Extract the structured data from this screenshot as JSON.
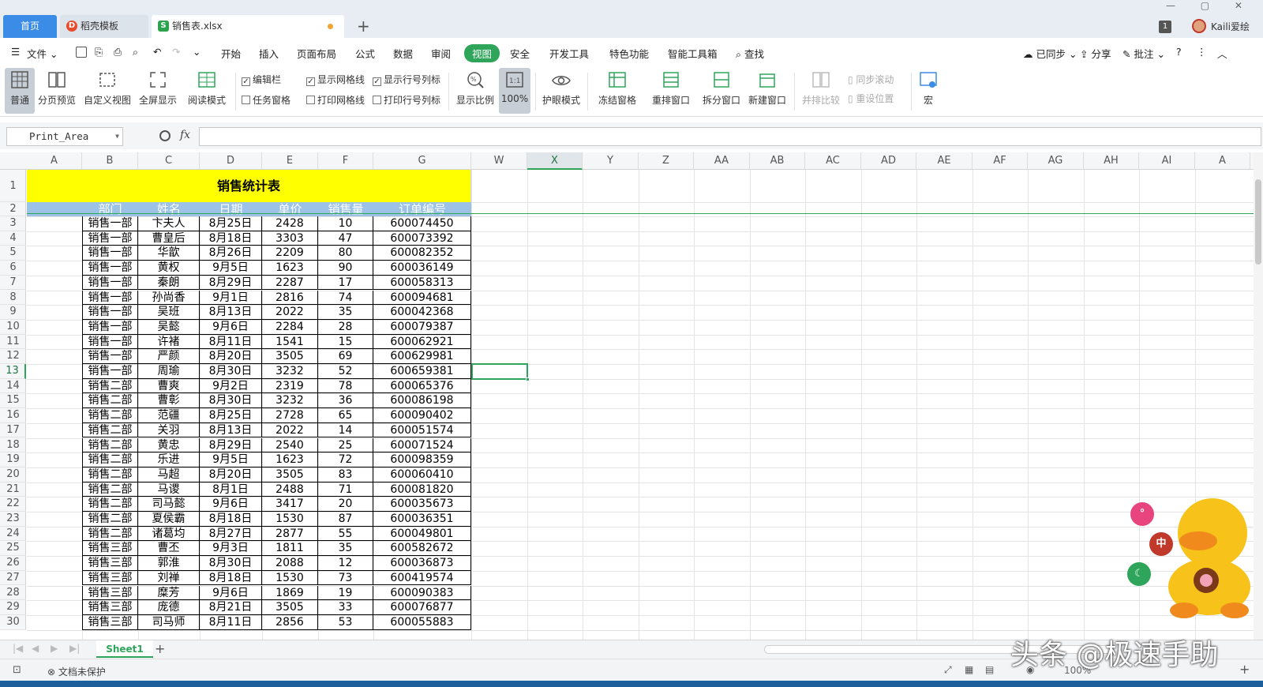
{
  "tabs": {
    "home": "首页",
    "template": "稻壳模板",
    "file": "销售表.xlsx",
    "file_icon": "S"
  },
  "top_right": {
    "badge": "1",
    "username": "Kaili爱绘"
  },
  "menu": {
    "file": "文件",
    "items": [
      "开始",
      "插入",
      "页面布局",
      "公式",
      "数据",
      "审阅",
      "视图",
      "安全",
      "开发工具",
      "特色功能",
      "智能工具箱"
    ],
    "search": "查找",
    "sync": "已同步",
    "share": "分享",
    "comment": "批注"
  },
  "ribbon": {
    "normal": "普通",
    "page_preview": "分页预览",
    "custom_view": "自定义视图",
    "fullscreen": "全屏显示",
    "reading_mode": "阅读模式",
    "edit_bar": "编辑栏",
    "task_pane": "任务窗格",
    "show_gridlines": "显示网格线",
    "print_gridlines": "打印网格线",
    "show_headings": "显示行号列标",
    "print_headings": "打印行号列标",
    "zoom": "显示比例",
    "zoom100": "100%",
    "eye_mode": "护眼模式",
    "freeze": "冻结窗格",
    "arrange": "重排窗口",
    "split": "拆分窗口",
    "new_window": "新建窗口",
    "side_by_side": "并排比较",
    "sync_scroll": "同步滚动",
    "reset_pos": "重设位置",
    "macro": "宏"
  },
  "formula_bar": {
    "name_box": "Print_Area",
    "fx": "fx",
    "value": ""
  },
  "columns": [
    "A",
    "B",
    "C",
    "D",
    "E",
    "F",
    "G",
    "W",
    "X",
    "Y",
    "Z",
    "AA",
    "AB",
    "AC",
    "AD",
    "AE",
    "AF",
    "AG",
    "AH",
    "AI",
    "A"
  ],
  "rows": [
    "1",
    "2",
    "3",
    "4",
    "5",
    "6",
    "7",
    "8",
    "9",
    "10",
    "11",
    "12",
    "13",
    "14",
    "15",
    "16",
    "17",
    "18",
    "19",
    "20",
    "21",
    "22",
    "23",
    "24",
    "25",
    "26",
    "27",
    "28",
    "29",
    "30"
  ],
  "sheet": {
    "title": "销售统计表",
    "headers": [
      "部门",
      "姓名",
      "日期",
      "单价",
      "销售量",
      "订单编号"
    ],
    "rows": [
      [
        "销售一部",
        "卞夫人",
        "8月25日",
        "2428",
        "10",
        "600074450"
      ],
      [
        "销售一部",
        "曹皇后",
        "8月18日",
        "3303",
        "47",
        "600073392"
      ],
      [
        "销售一部",
        "华歆",
        "8月26日",
        "2209",
        "80",
        "600082352"
      ],
      [
        "销售一部",
        "黄权",
        "9月5日",
        "1623",
        "90",
        "600036149"
      ],
      [
        "销售一部",
        "秦朗",
        "8月29日",
        "2287",
        "17",
        "600058313"
      ],
      [
        "销售一部",
        "孙尚香",
        "9月1日",
        "2816",
        "74",
        "600094681"
      ],
      [
        "销售一部",
        "吴班",
        "8月13日",
        "2022",
        "35",
        "600042368"
      ],
      [
        "销售一部",
        "吴懿",
        "9月6日",
        "2284",
        "28",
        "600079387"
      ],
      [
        "销售一部",
        "许褚",
        "8月11日",
        "1541",
        "15",
        "600062921"
      ],
      [
        "销售一部",
        "严颜",
        "8月20日",
        "3505",
        "69",
        "600629981"
      ],
      [
        "销售一部",
        "周瑜",
        "8月30日",
        "3232",
        "52",
        "600659381"
      ],
      [
        "销售二部",
        "曹爽",
        "9月2日",
        "2319",
        "78",
        "600065376"
      ],
      [
        "销售二部",
        "曹彰",
        "8月30日",
        "3232",
        "36",
        "600086198"
      ],
      [
        "销售二部",
        "范疆",
        "8月25日",
        "2728",
        "65",
        "600090402"
      ],
      [
        "销售二部",
        "关羽",
        "8月13日",
        "2022",
        "14",
        "600051574"
      ],
      [
        "销售二部",
        "黄忠",
        "8月29日",
        "2540",
        "25",
        "600071524"
      ],
      [
        "销售二部",
        "乐进",
        "9月5日",
        "1623",
        "72",
        "600098359"
      ],
      [
        "销售二部",
        "马超",
        "8月20日",
        "3505",
        "83",
        "600060410"
      ],
      [
        "销售二部",
        "马谡",
        "8月1日",
        "2488",
        "71",
        "600081820"
      ],
      [
        "销售二部",
        "司马懿",
        "9月6日",
        "3417",
        "20",
        "600035673"
      ],
      [
        "销售二部",
        "夏侯霸",
        "8月18日",
        "1530",
        "87",
        "600036351"
      ],
      [
        "销售二部",
        "诸葛均",
        "8月27日",
        "2877",
        "55",
        "600049801"
      ],
      [
        "销售三部",
        "曹丕",
        "9月3日",
        "1811",
        "35",
        "600582672"
      ],
      [
        "销售三部",
        "郭淮",
        "8月30日",
        "2088",
        "12",
        "600036873"
      ],
      [
        "销售三部",
        "刘禅",
        "8月18日",
        "1530",
        "73",
        "600419574"
      ],
      [
        "销售三部",
        "糜芳",
        "9月6日",
        "1869",
        "19",
        "600090383"
      ],
      [
        "销售三部",
        "庞德",
        "8月21日",
        "3505",
        "33",
        "600076877"
      ],
      [
        "销售三部",
        "司马师",
        "8月11日",
        "2856",
        "53",
        "600055883"
      ]
    ]
  },
  "sheet_tabs": [
    "Sheet1"
  ],
  "status": {
    "protect": "文档未保护",
    "zoom": "100%"
  },
  "overlay": {
    "watermark": "头条 @极速手助",
    "float_btn_cn": "中"
  },
  "colors": {
    "accent": "#2ea55a",
    "title_fill": "#ffff00",
    "header_fill": "#9cc3e6",
    "home_tab": "#3b8ce6"
  }
}
